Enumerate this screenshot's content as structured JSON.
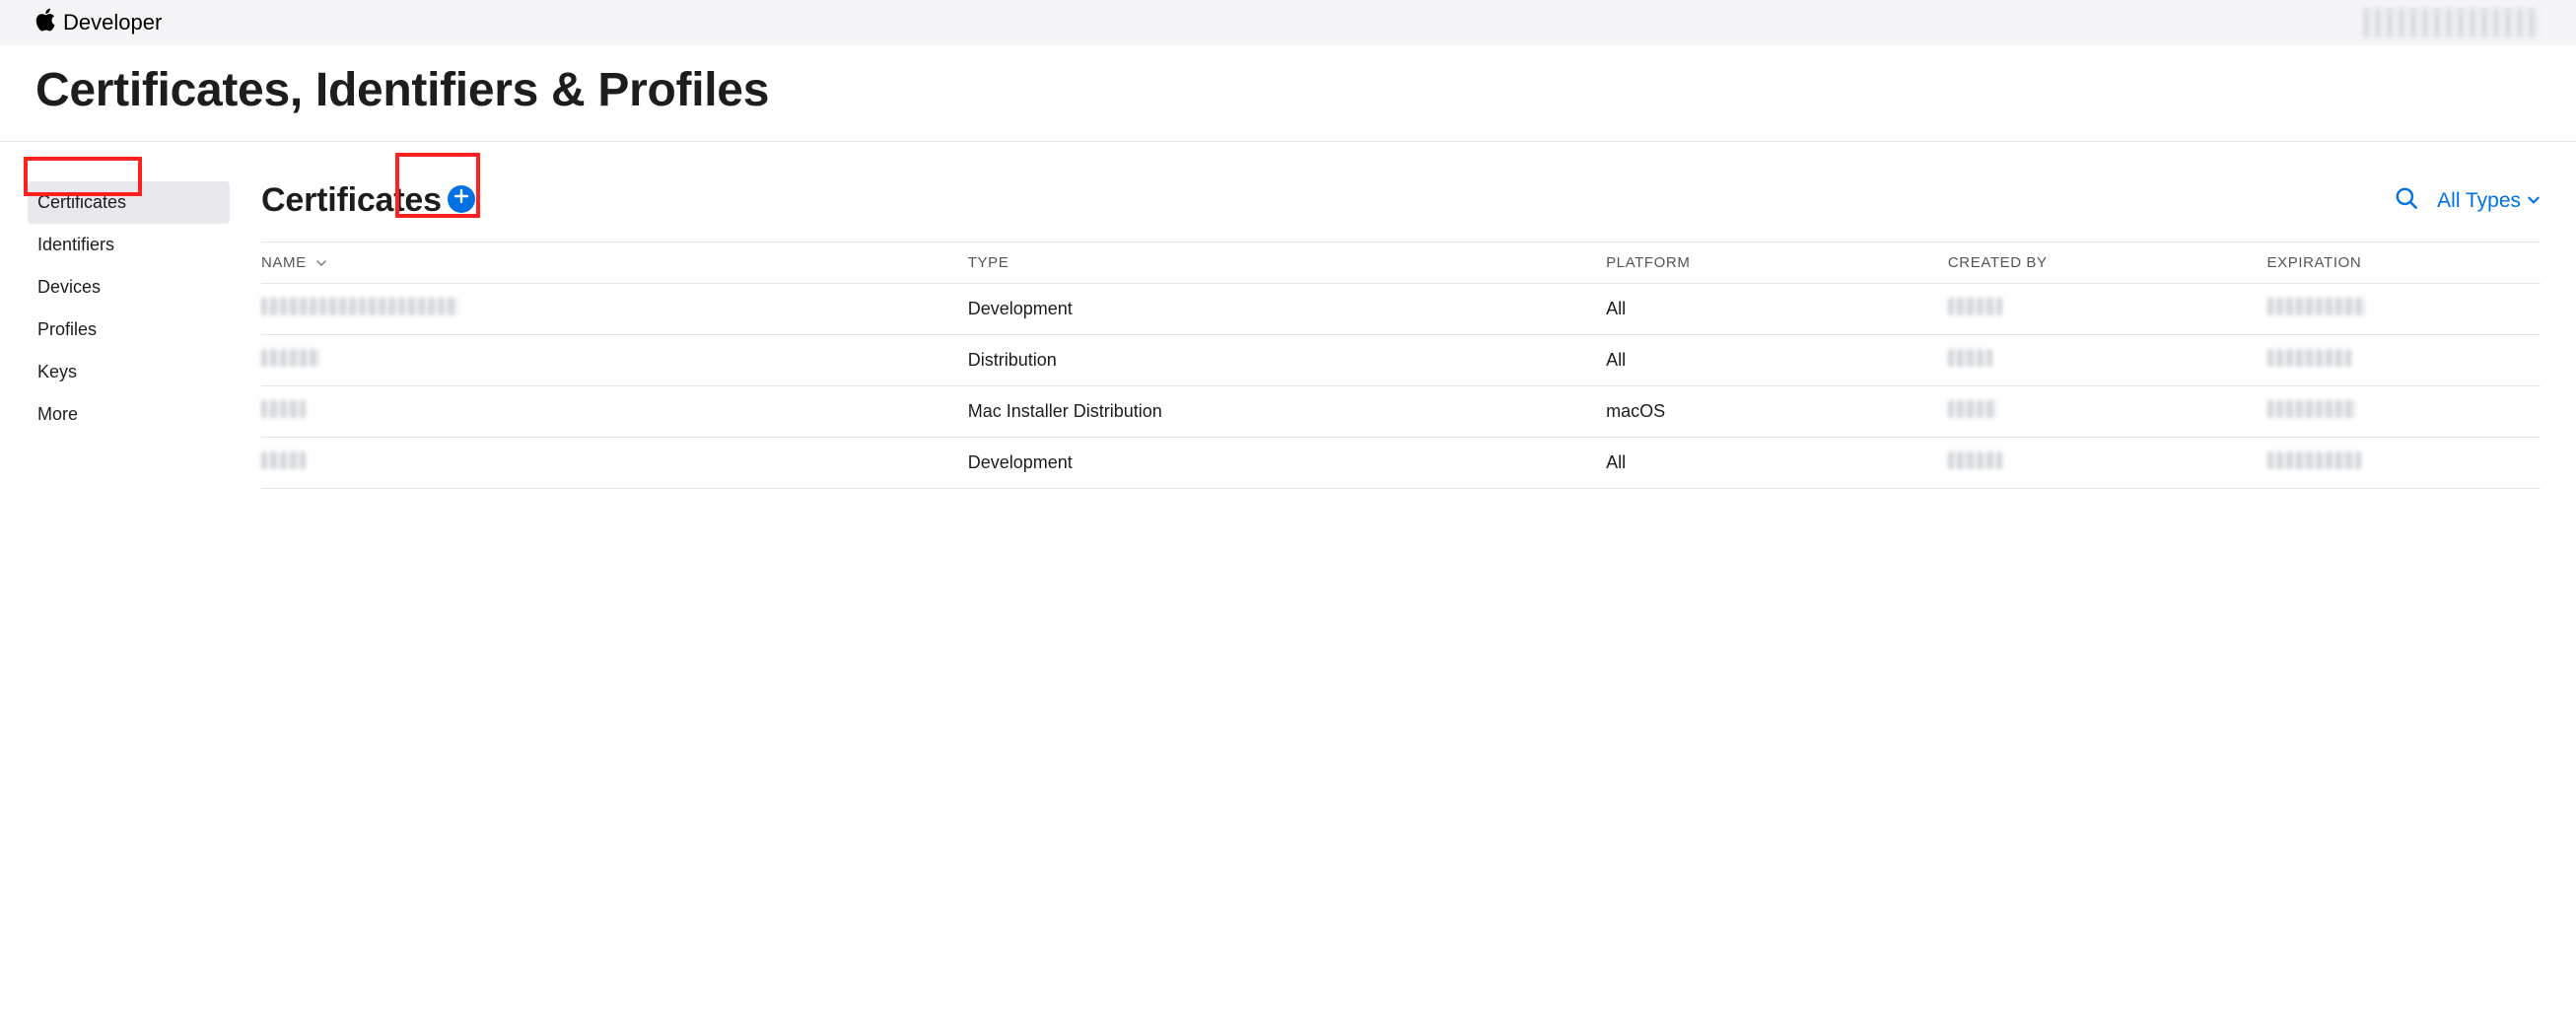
{
  "brand": "Developer",
  "page_title": "Certificates, Identifiers & Profiles",
  "sidebar": {
    "items": [
      {
        "label": "Certificates",
        "active": true
      },
      {
        "label": "Identifiers",
        "active": false
      },
      {
        "label": "Devices",
        "active": false
      },
      {
        "label": "Profiles",
        "active": false
      },
      {
        "label": "Keys",
        "active": false
      },
      {
        "label": "More",
        "active": false
      }
    ]
  },
  "section": {
    "title": "Certificates",
    "filter_label": "All Types"
  },
  "table": {
    "columns": {
      "name": "NAME",
      "type": "TYPE",
      "platform": "PLATFORM",
      "created_by": "CREATED BY",
      "expiration": "EXPIRATION"
    },
    "rows": [
      {
        "name": "",
        "type": "Development",
        "platform": "All",
        "created_by": "",
        "expiration": ""
      },
      {
        "name": "",
        "type": "Distribution",
        "platform": "All",
        "created_by": "",
        "expiration": ""
      },
      {
        "name": "",
        "type": "Mac Installer Distribution",
        "platform": "macOS",
        "created_by": "",
        "expiration": ""
      },
      {
        "name": "",
        "type": "Development",
        "platform": "All",
        "created_by": "",
        "expiration": ""
      }
    ]
  }
}
